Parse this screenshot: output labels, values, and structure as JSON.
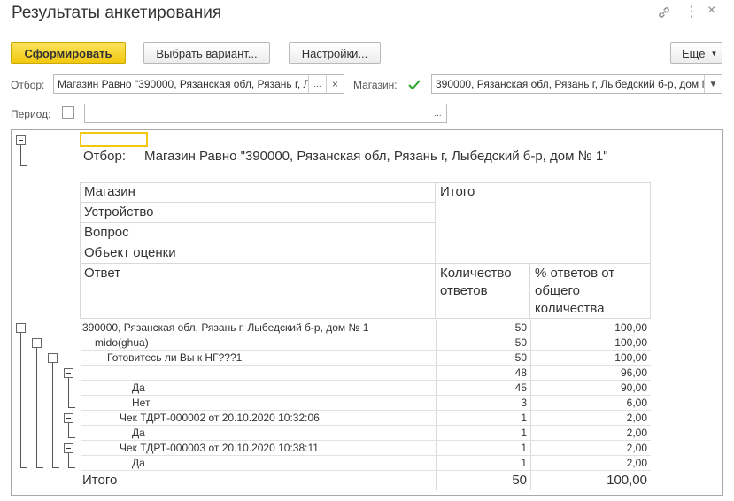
{
  "window": {
    "title": "Результаты анкетирования"
  },
  "toolbar": {
    "generate_label": "Сформировать",
    "select_variant_label": "Выбрать вариант...",
    "settings_label": "Настройки...",
    "more_label": "Еще"
  },
  "filters": {
    "filter_label": "Отбор:",
    "filter_value": "Магазин Равно \"390000, Рязанская обл, Рязань г, Лыбедский б-р, дом № 1\"",
    "filter_select": "...",
    "filter_clear": "×",
    "store_label": "Магазин:",
    "store_checked": true,
    "store_value": "390000, Рязанская обл, Рязань г, Лыбедский б-р, дом № 1",
    "period_label": "Период:",
    "period_checked": false,
    "period_value": "",
    "period_select": "..."
  },
  "report": {
    "filter_caption": "Отбор:",
    "filter_text": "Магазин Равно \"390000, Рязанская обл, Рязань г, Лыбедский б-р, дом № 1\"",
    "header": {
      "group_labels": [
        "Магазин",
        "Устройство",
        "Вопрос",
        "Объект оценки"
      ],
      "answer_label": "Ответ",
      "total_label": "Итого",
      "count_label": "Количество ответов",
      "percent_label": "% ответов от общего количества"
    },
    "rows": [
      {
        "label": "390000, Рязанская обл, Рязань г, Лыбедский б-р, дом № 1",
        "count": "50",
        "percent": "100,00"
      },
      {
        "label": "mido(ghua)",
        "count": "50",
        "percent": "100,00"
      },
      {
        "label": "Готовитесь ли Вы к НГ???1",
        "count": "50",
        "percent": "100,00"
      },
      {
        "label": "",
        "count": "48",
        "percent": "96,00"
      },
      {
        "label": "Да",
        "count": "45",
        "percent": "90,00"
      },
      {
        "label": "Нет",
        "count": "3",
        "percent": "6,00"
      },
      {
        "label": "Чек ТДРТ-000002 от 20.10.2020 10:32:06",
        "count": "1",
        "percent": "2,00"
      },
      {
        "label": "Да",
        "count": "1",
        "percent": "2,00"
      },
      {
        "label": "Чек ТДРТ-000003 от 20.10.2020 10:38:11",
        "count": "1",
        "percent": "2,00"
      },
      {
        "label": "Да",
        "count": "1",
        "percent": "2,00"
      }
    ],
    "total": {
      "label": "Итого",
      "count": "50",
      "percent": "100,00"
    }
  }
}
